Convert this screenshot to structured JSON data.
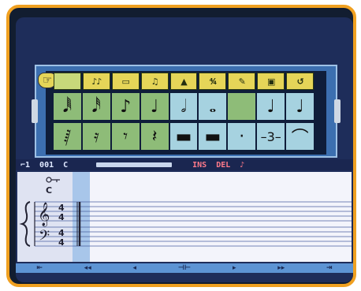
{
  "palette": {
    "pointer_glyph": "☞",
    "tabs": [
      {
        "label": "",
        "icon": "selector-icon"
      },
      {
        "label": "♪♪",
        "icon": "notes-icon"
      },
      {
        "label": "▭",
        "icon": "measure-icon"
      },
      {
        "label": "♫",
        "icon": "beams-icon"
      },
      {
        "label": "▲",
        "icon": "dynamics-icon"
      },
      {
        "label": "⁴⁄₄",
        "icon": "time-signature-icon"
      },
      {
        "label": "✎",
        "icon": "eraser-icon"
      },
      {
        "label": "▣",
        "icon": "clef-icon"
      },
      {
        "label": "↺",
        "icon": "undo-icon"
      }
    ],
    "notes": [
      "𝅘𝅥𝅱",
      "𝅘𝅥𝅰",
      "♪",
      "♩",
      "𝅗𝅥",
      "𝅝",
      "",
      "♩",
      "♩"
    ],
    "rests": [
      "𝅁",
      "𝄿",
      "𝄾",
      "𝄽",
      "▬",
      "▬",
      "·",
      "–3–",
      "⌒"
    ]
  },
  "status": {
    "voice_label": "⌐1",
    "measure": "001",
    "key": "C",
    "ins_label": "INS",
    "del_label": "DEL",
    "end_glyph": "♪"
  },
  "score": {
    "key_label": "C",
    "time_signature_top": "4",
    "time_signature_bottom": "4"
  },
  "nav": {
    "first": "⇤",
    "rewind": "◂◂",
    "back": "◂",
    "cursor": "⊣⊢",
    "forward": "▸",
    "fast_forward": "▸▸",
    "last": "⇥"
  },
  "colors": {
    "bezel": "#f0a020",
    "screen": "#1e2d5a",
    "palette_frame": "#3c6fb0",
    "tab_yellow": "#e5d558",
    "cell_green": "#8ebc78",
    "cell_blue": "#a6d2e0",
    "staff_paper": "#f3f4fb",
    "strip_blue": "#a8c6ea",
    "nav_blue": "#5d94d4",
    "warning_red": "#ff7a8a"
  }
}
